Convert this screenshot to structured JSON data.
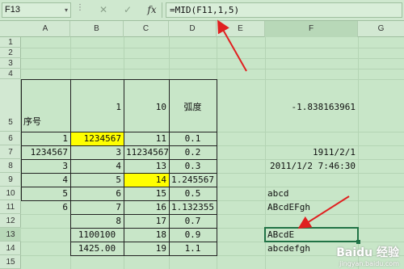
{
  "formula_bar": {
    "name_box": "F13",
    "name_box_arrow": "▾",
    "dots": "⋮",
    "cancel_icon": "✕",
    "enter_icon": "✓",
    "fx_icon": "fx",
    "formula": "=MID(F11,1,5)"
  },
  "columns": [
    "A",
    "B",
    "C",
    "D",
    "E",
    "F",
    "G"
  ],
  "rows": [
    "1",
    "2",
    "3",
    "4",
    "5",
    "6",
    "7",
    "8",
    "9",
    "10",
    "11",
    "12",
    "13",
    "14",
    "15"
  ],
  "cells": {
    "a5": "序号",
    "b5": "1",
    "c5": "10",
    "d5": "弧度",
    "f5": "-1.838163961",
    "a6": "1",
    "b6": "1234567",
    "c6": "11",
    "d6": "0.1",
    "a7": "1234567",
    "b7": "3",
    "c7": "11234567",
    "d7": "0.2",
    "f7": "1911/2/1",
    "a8": "3",
    "b8": "4",
    "c8": "13",
    "d8": "0.3",
    "f8": "2011/1/2 7:46:30",
    "a9": "4",
    "b9": "5",
    "c9": "14",
    "d9": "1.245567",
    "a10": "5",
    "b10": "6",
    "c10": "15",
    "d10": "0.5",
    "f10": "abcd",
    "a11": "6",
    "b11": "7",
    "c11": "16",
    "d11": "1.132355",
    "f11": "ABcdEFgh",
    "b12": "8",
    "c12": "17",
    "d12": "0.7",
    "b13": "1100100",
    "c13": "18",
    "d13": "0.9",
    "f13": "ABcdE",
    "b14": "1425.00",
    "c14": "19",
    "d14": "1.1",
    "f14": "abcdefgh"
  },
  "colors": {
    "highlight": "#ffff00",
    "selection": "#217346",
    "arrow": "#e02020",
    "sheet_bg": "#c8e6c8"
  },
  "watermark": {
    "title": "Baidu 经验",
    "sub": "jingyan.baidu.com"
  }
}
